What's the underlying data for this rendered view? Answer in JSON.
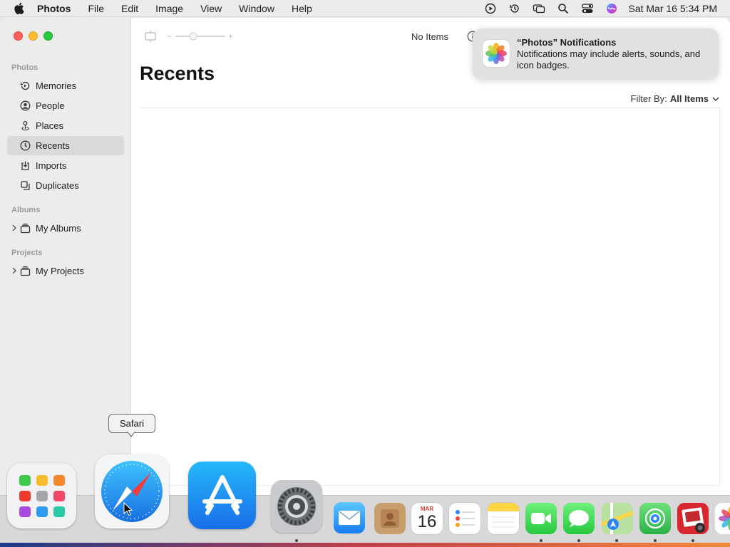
{
  "menubar": {
    "app_name": "Photos",
    "menus": [
      "File",
      "Edit",
      "Image",
      "View",
      "Window",
      "Help"
    ],
    "clock": "Sat Mar 16  5:34 PM"
  },
  "sidebar": {
    "section_photos": "Photos",
    "items": [
      {
        "label": "Memories"
      },
      {
        "label": "People"
      },
      {
        "label": "Places"
      },
      {
        "label": "Recents"
      },
      {
        "label": "Imports"
      },
      {
        "label": "Duplicates"
      }
    ],
    "section_albums": "Albums",
    "my_albums": "My Albums",
    "section_projects": "Projects",
    "my_projects": "My Projects"
  },
  "toolbar": {
    "items_count": "No Items"
  },
  "main": {
    "title": "Recents",
    "filter_label": "Filter By:",
    "filter_value": "All Items"
  },
  "notification": {
    "title": "“Photos” Notifications",
    "body": "Notifications may include alerts, sounds, and icon badges."
  },
  "tooltip": {
    "text": "Safari"
  },
  "calendar_icon": {
    "month": "MAR",
    "day": "16"
  },
  "colors": {
    "selection": "#dadadb",
    "accent": "#1a7cf5"
  }
}
